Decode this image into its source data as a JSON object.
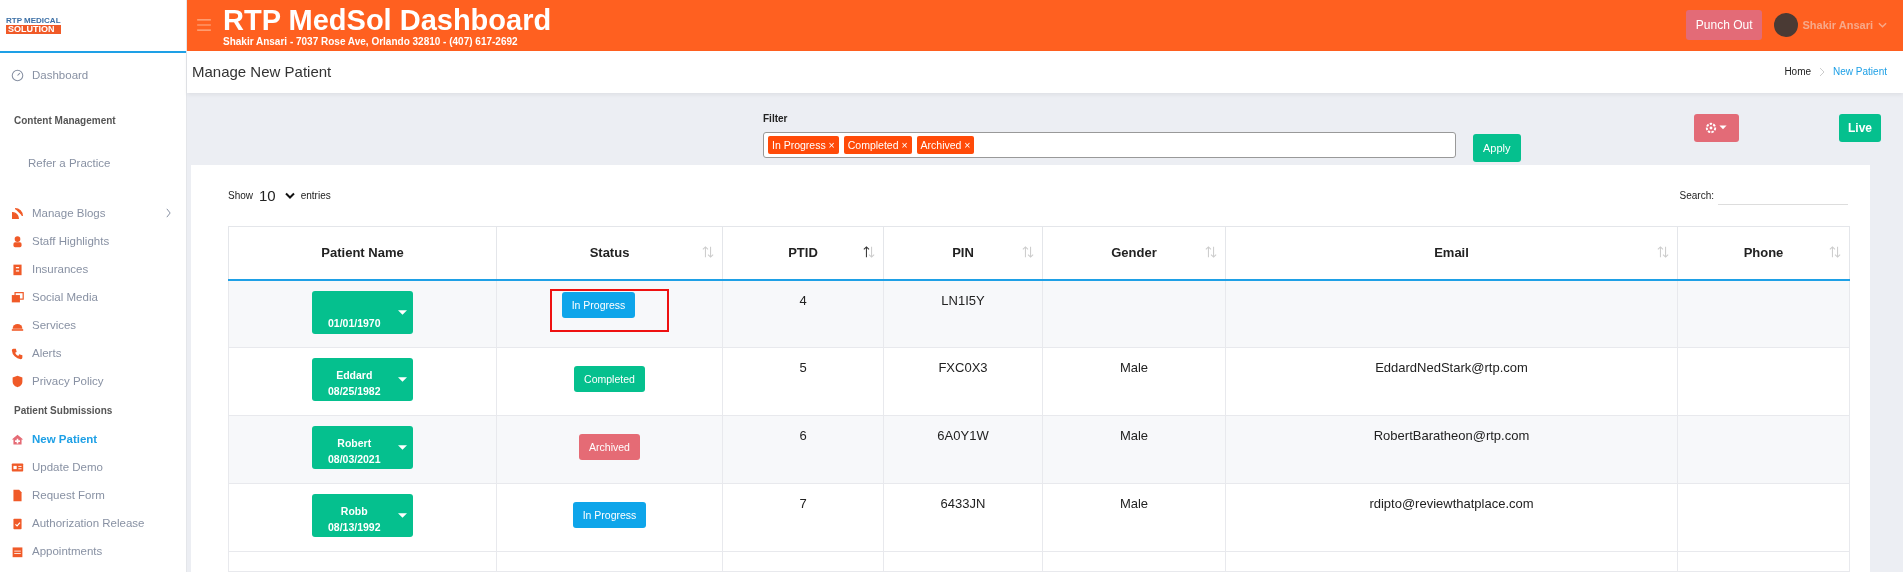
{
  "logo": {
    "line_1": "RTP MEDICAL",
    "line_2": "SOLUTION"
  },
  "header": {
    "title": "RTP MedSol Dashboard",
    "subtitle": "Shakir Ansari - 7037 Rose Ave, Orlando 32810 - (407) 617-2692",
    "punch_button": "Punch Out",
    "user_name": "Shakir Ansari"
  },
  "sidebar": {
    "sections": [
      {
        "items": [
          {
            "label": "Dashboard",
            "selected": false,
            "expandable": false
          }
        ]
      },
      {
        "heading": "Content Management",
        "items": [
          {
            "label": "Refer a Practice",
            "selected": false,
            "expandable": false
          },
          {
            "label": "Manage Blogs",
            "selected": false,
            "expandable": true
          },
          {
            "label": "Staff Highlights",
            "selected": false,
            "expandable": false
          },
          {
            "label": "Insurances",
            "selected": false,
            "expandable": false
          },
          {
            "label": "Social Media",
            "selected": false,
            "expandable": false
          },
          {
            "label": "Services",
            "selected": false,
            "expandable": false
          },
          {
            "label": "Alerts",
            "selected": false,
            "expandable": false
          },
          {
            "label": "Privacy Policy",
            "selected": false,
            "expandable": false
          }
        ]
      },
      {
        "heading": "Patient Submissions",
        "items": [
          {
            "label": "New Patient",
            "selected": true,
            "expandable": false
          },
          {
            "label": "Update Demo",
            "selected": false,
            "expandable": false
          },
          {
            "label": "Request Form",
            "selected": false,
            "expandable": false
          },
          {
            "label": "Authorization Release",
            "selected": false,
            "expandable": false
          },
          {
            "label": "Appointments",
            "selected": false,
            "expandable": false
          }
        ]
      }
    ]
  },
  "page": {
    "title": "Manage New Patient",
    "breadcrumb": [
      {
        "label": "Home",
        "selected": false
      },
      {
        "label": "New Patient",
        "selected": true
      }
    ]
  },
  "filter": {
    "label": "Filter",
    "tags": [
      "In Progress ×",
      "Completed ×",
      "Archived ×"
    ],
    "apply_button": "Apply",
    "live_button": "Live"
  },
  "table_controls": {
    "show_label": "Show",
    "page_size": "10",
    "entries_label": "entries",
    "search_label": "Search:"
  },
  "table": {
    "columns": [
      {
        "label": "Patient Name"
      },
      {
        "label": "Status",
        "sorted": false
      },
      {
        "label": "PTID",
        "sorted": true
      },
      {
        "label": "PIN",
        "sorted": false
      },
      {
        "label": "Gender",
        "sorted": false
      },
      {
        "label": "Email",
        "sorted": false
      },
      {
        "label": "Phone",
        "sorted": false
      }
    ],
    "rows": [
      {
        "dob": "01/01/1970",
        "status": "In Progress",
        "color": "#0ea5ea",
        "highlighted": true,
        "ptid": "4",
        "pin": "LN1I5Y"
      },
      {
        "name": "Eddard",
        "dob": "08/25/1982",
        "status": "Completed",
        "color": "#05c08e",
        "highlighted": false,
        "ptid": "5",
        "pin": "FXC0X3",
        "gender": "Male",
        "email": "EddardNedStark@rtp.com"
      },
      {
        "name": "Robert",
        "dob": "08/03/2021",
        "status": "Archived",
        "color": "#e56b75",
        "highlighted": false,
        "ptid": "6",
        "pin": "6A0Y1W",
        "gender": "Male",
        "email": "RobertBaratheon@rtp.com"
      },
      {
        "name": "Robb",
        "dob": "08/13/1992",
        "status": "In Progress",
        "color": "#0ea5ea",
        "highlighted": false,
        "ptid": "7",
        "pin": "6433JN",
        "gender": "Male",
        "email": "rdipto@reviewthatplace.com"
      }
    ]
  }
}
